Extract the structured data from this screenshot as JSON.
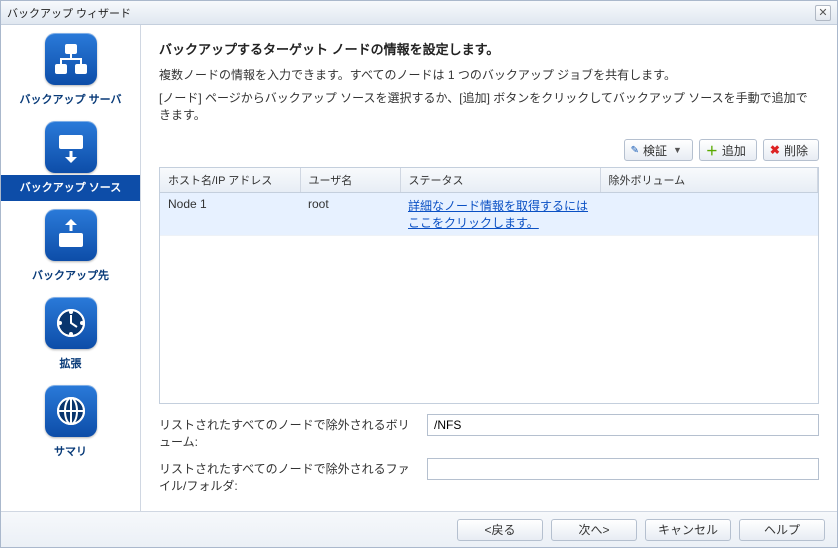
{
  "window": {
    "title": "バックアップ ウィザード"
  },
  "sidebar": {
    "items": [
      {
        "label": "バックアップ サーバ",
        "icon": "network-icon"
      },
      {
        "label": "バックアップ ソース",
        "icon": "drive-down-icon"
      },
      {
        "label": "バックアップ先",
        "icon": "drive-up-icon"
      },
      {
        "label": "拡張",
        "icon": "clock-icon"
      },
      {
        "label": "サマリ",
        "icon": "globe-icon"
      }
    ],
    "active_index": 1
  },
  "header": {
    "title": "バックアップするターゲット ノードの情報を設定します。",
    "line1": "複数ノードの情報を入力できます。すべてのノードは 1 つのバックアップ ジョブを共有します。",
    "line2": "[ノード] ページからバックアップ ソースを選択するか、[追加] ボタンをクリックしてバックアップ ソースを手動で追加できます。"
  },
  "toolbar": {
    "verify_label": "検証",
    "add_label": "追加",
    "delete_label": "削除"
  },
  "table": {
    "columns": {
      "host": "ホスト名/IP アドレス",
      "user": "ユーザ名",
      "status": "ステータス",
      "excluded": "除外ボリューム"
    },
    "rows": [
      {
        "host": "Node 1",
        "user": "root",
        "status_link": "詳細なノード情報を取得するにはここをクリックします。",
        "excluded": ""
      }
    ]
  },
  "form": {
    "excluded_volume_label": "リストされたすべてのノードで除外されるボリューム:",
    "excluded_volume_value": "/NFS",
    "excluded_files_label": "リストされたすべてのノードで除外されるファイル/フォルダ:",
    "excluded_files_value": ""
  },
  "footer": {
    "back": "<戻る",
    "next": "次へ>",
    "cancel": "キャンセル",
    "help": "ヘルプ"
  }
}
